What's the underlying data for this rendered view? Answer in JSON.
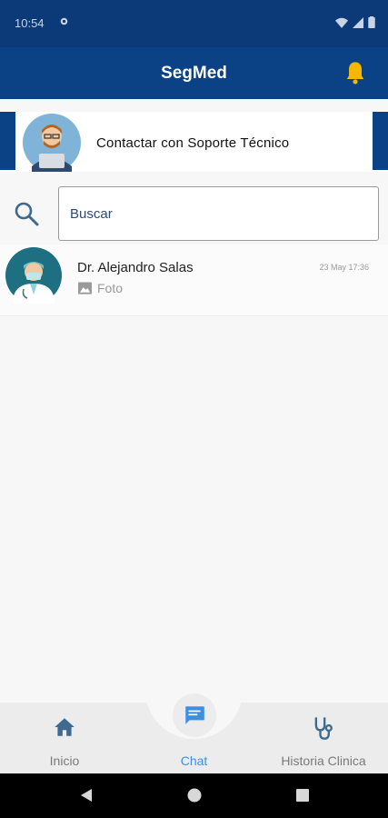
{
  "status_bar": {
    "time": "10:54"
  },
  "app_bar": {
    "title": "SegMed"
  },
  "support": {
    "label": "Contactar con Soporte Técnico"
  },
  "search": {
    "placeholder": "Buscar"
  },
  "chats": [
    {
      "name": "Dr. Alejandro Salas",
      "date": "23 May 17:36",
      "preview": "Foto"
    }
  ],
  "bottom_nav": {
    "items": [
      {
        "label": "Inicio",
        "icon": "home-icon"
      },
      {
        "label": "Chat",
        "icon": "chat-icon",
        "active": true
      },
      {
        "label": "Historia Clinica",
        "icon": "stethoscope-icon"
      }
    ]
  },
  "colors": {
    "primary": "#0b4286",
    "accent": "#3d8fe6",
    "bell": "#f5b800"
  }
}
